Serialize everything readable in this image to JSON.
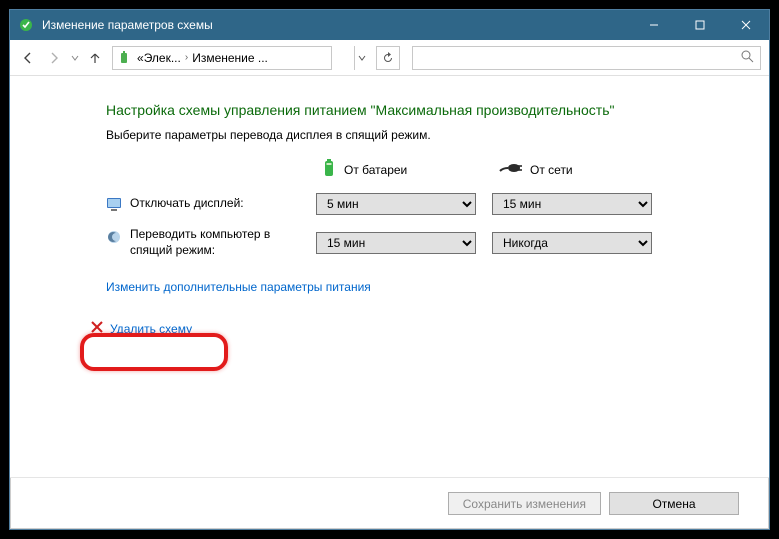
{
  "titlebar": {
    "title": "Изменение параметров схемы"
  },
  "breadcrumb": {
    "prefix": "«",
    "part1": "Элек...",
    "part2": "Изменение ..."
  },
  "search": {
    "placeholder": ""
  },
  "content": {
    "heading": "Настройка схемы управления питанием \"Максимальная производительность\"",
    "subtext": "Выберите параметры перевода дисплея в спящий режим.",
    "col_battery": "От батареи",
    "col_ac": "От сети",
    "rows": [
      {
        "label": "Отключать дисплей:",
        "battery_value": "5 мин",
        "ac_value": "15 мин"
      },
      {
        "label": "Переводить компьютер в спящий режим:",
        "battery_value": "15 мин",
        "ac_value": "Никогда"
      }
    ],
    "advanced_link": "Изменить дополнительные параметры питания",
    "delete_link": "Удалить схему"
  },
  "footer": {
    "save": "Сохранить изменения",
    "cancel": "Отмена"
  }
}
